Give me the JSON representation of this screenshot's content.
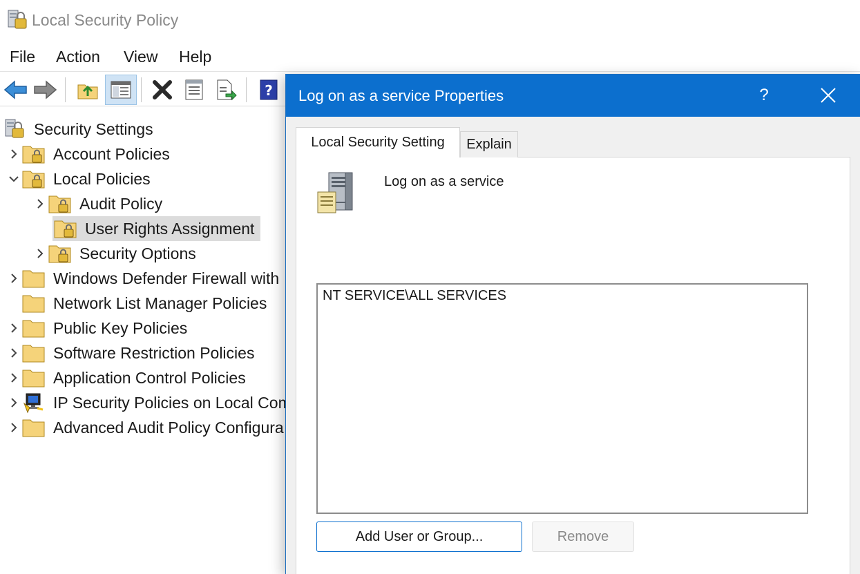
{
  "window": {
    "title": "Local Security Policy"
  },
  "menu": {
    "items": [
      "File",
      "Action",
      "View",
      "Help"
    ]
  },
  "toolbar": {
    "icons": [
      "back-arrow-icon",
      "forward-arrow-icon",
      "up-folder-icon",
      "show-hide-console-tree-icon",
      "delete-icon",
      "properties-icon",
      "export-list-icon",
      "help-icon"
    ]
  },
  "tree": {
    "items": [
      {
        "label": "Security Settings",
        "icon": "security-settings-icon",
        "expander": "none"
      },
      {
        "label": "Account Policies",
        "icon": "locked-folder-icon",
        "expander": "collapsed"
      },
      {
        "label": "Local Policies",
        "icon": "locked-folder-icon",
        "expander": "expanded"
      },
      {
        "label": "Audit Policy",
        "icon": "locked-folder-icon",
        "expander": "collapsed"
      },
      {
        "label": "User Rights Assignment",
        "icon": "locked-folder-icon",
        "expander": "none",
        "selected": true
      },
      {
        "label": "Security Options",
        "icon": "locked-folder-icon",
        "expander": "collapsed"
      },
      {
        "label": "Windows Defender Firewall with",
        "icon": "folder-icon",
        "expander": "collapsed"
      },
      {
        "label": "Network List Manager Policies",
        "icon": "folder-icon",
        "expander": "none"
      },
      {
        "label": "Public Key Policies",
        "icon": "folder-icon",
        "expander": "collapsed"
      },
      {
        "label": "Software Restriction Policies",
        "icon": "folder-icon",
        "expander": "collapsed"
      },
      {
        "label": "Application Control Policies",
        "icon": "folder-icon",
        "expander": "collapsed"
      },
      {
        "label": "IP Security Policies on Local Com",
        "icon": "ip-security-icon",
        "expander": "collapsed"
      },
      {
        "label": "Advanced Audit Policy Configura",
        "icon": "folder-icon",
        "expander": "collapsed"
      }
    ]
  },
  "dialog": {
    "title": "Log on as a service Properties",
    "help_glyph": "?",
    "tabs": [
      {
        "label": "Local Security Setting",
        "active": true
      },
      {
        "label": "Explain",
        "active": false
      }
    ],
    "policy_name": "Log on as a service",
    "members": [
      "NT SERVICE\\ALL SERVICES"
    ],
    "buttons": {
      "add": "Add User or Group...",
      "remove": "Remove"
    }
  },
  "colors": {
    "dialog_titlebar": "#0c6fce",
    "selection": "#dcdcdc",
    "folder": "#f5d37a"
  }
}
